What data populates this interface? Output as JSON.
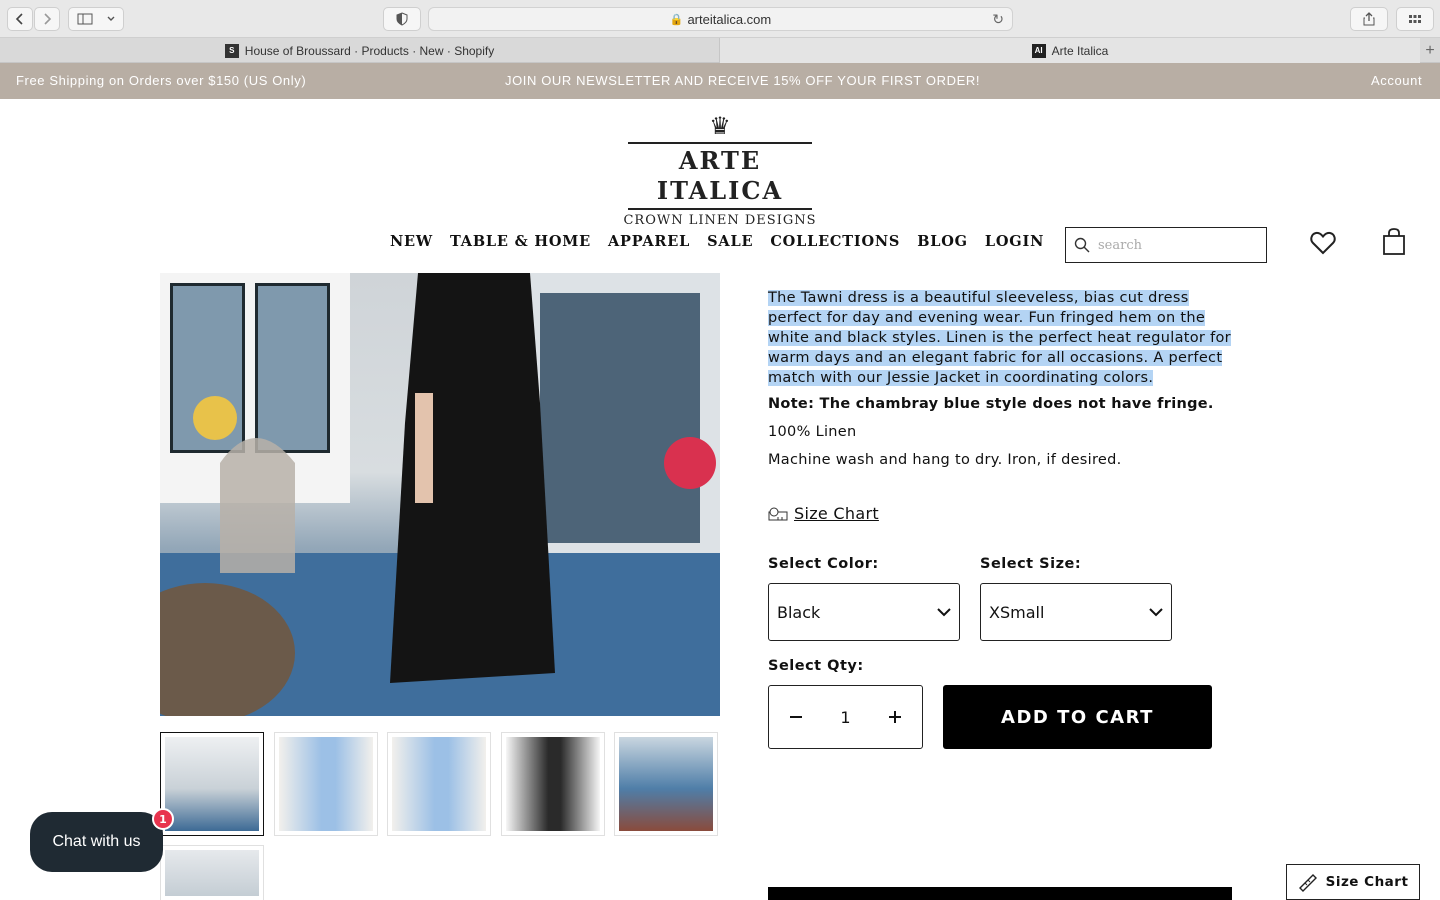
{
  "browser": {
    "url": "arteitalica.com",
    "tabs": [
      {
        "label": "House of Broussard · Products · New · Shopify",
        "favicon": "S"
      },
      {
        "label": "Arte Italica",
        "favicon": "AI"
      }
    ]
  },
  "promo": {
    "left": "Free Shipping on Orders over $150 (US Only)",
    "center": "JOIN OUR NEWSLETTER AND RECEIVE 15% OFF YOUR FIRST ORDER!",
    "right": "Account"
  },
  "logo": {
    "name": "ARTE ITALICA",
    "subtitle": "CROWN LINEN DESIGNS"
  },
  "nav": {
    "items": [
      "NEW",
      "TABLE & HOME",
      "APPAREL",
      "SALE",
      "COLLECTIONS",
      "BLOG",
      "LOGIN"
    ],
    "search_placeholder": "search"
  },
  "product": {
    "description_lines": [
      "The Tawni dress is a beautiful sleeveless, bias cut dress",
      "perfect for day and evening wear.  Fun fringed hem on the",
      "white and black styles. Linen is the perfect heat regulator for",
      "warm days and an elegant fabric for all occasions. A perfect",
      "match with our Jessie Jacket in coordinating colors."
    ],
    "note": "Note: The chambray blue style does not have fringe.",
    "material": "100% Linen",
    "care": "Machine wash and hang to dry. Iron, if desired.",
    "size_chart_link": "Size Chart",
    "color_label": "Select Color:",
    "color_value": "Black",
    "size_label": "Select Size:",
    "size_value": "XSmall",
    "qty_label": "Select Qty:",
    "qty_value": "1",
    "add_to_cart": "ADD TO CART"
  },
  "chat": {
    "label": "Chat with us",
    "badge": "1"
  },
  "size_chart_button": "Size Chart",
  "colors": {
    "promo_bg": "#b8aea4",
    "chat_bg": "#1f2a33",
    "badge": "#e8344e",
    "selection": "#b4d4f4"
  }
}
